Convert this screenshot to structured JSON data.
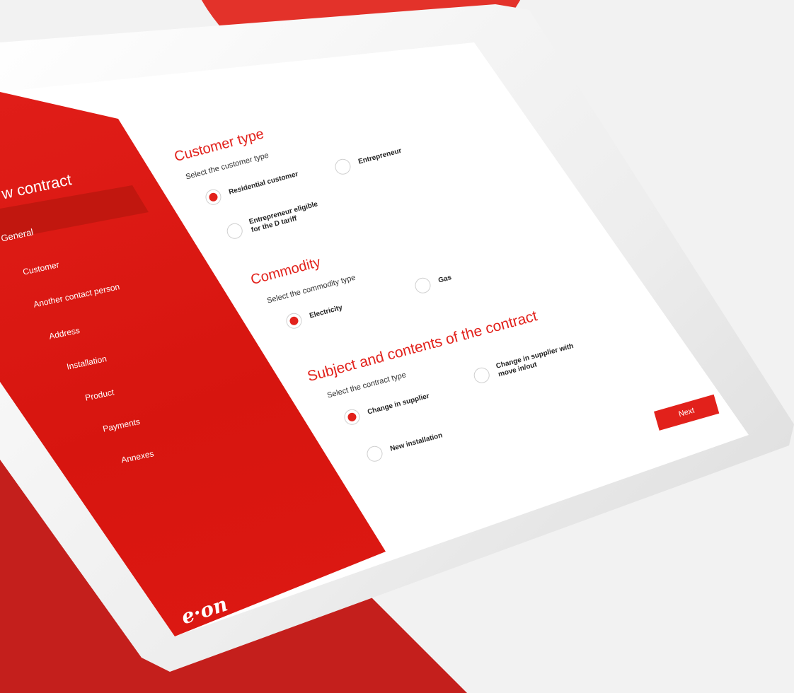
{
  "sidebar": {
    "title": "w contract",
    "items": [
      {
        "label": "General",
        "active": true
      },
      {
        "label": "Customer"
      },
      {
        "label": "Another contact person"
      },
      {
        "label": "Address"
      },
      {
        "label": "Installation"
      },
      {
        "label": "Product"
      },
      {
        "label": "Payments"
      },
      {
        "label": "Annexes"
      }
    ],
    "logo": "e·on"
  },
  "customer_type": {
    "heading": "Customer type",
    "prompt": "Select the customer type",
    "options": [
      {
        "label_line1": "Residential customer",
        "label_line2": "",
        "selected": true
      },
      {
        "label_line1": "Entrepreneur",
        "label_line2": "",
        "selected": false
      },
      {
        "label_line1": "Entrepreneur eligible",
        "label_line2": "for the D tariff",
        "selected": false
      }
    ]
  },
  "commodity": {
    "heading": "Commodity",
    "prompt": "Select the commodity type",
    "options": [
      {
        "label_line1": "Electricity",
        "selected": true
      },
      {
        "label_line1": "Gas",
        "selected": false
      }
    ]
  },
  "contract": {
    "heading": "Subject and contents of the contract",
    "prompt": "Select the contract type",
    "options": [
      {
        "label_line1": "Change in supplier",
        "label_line2": "",
        "selected": true
      },
      {
        "label_line1": "Change in supplier with",
        "label_line2": "move in/out",
        "selected": false
      },
      {
        "label_line1": "New installation",
        "label_line2": "",
        "selected": false
      }
    ]
  },
  "actions": {
    "next_label": "Next"
  },
  "colors": {
    "brand_red": "#e2211b",
    "sidebar_red": "#d7150f",
    "active_band": "#c1170f"
  }
}
